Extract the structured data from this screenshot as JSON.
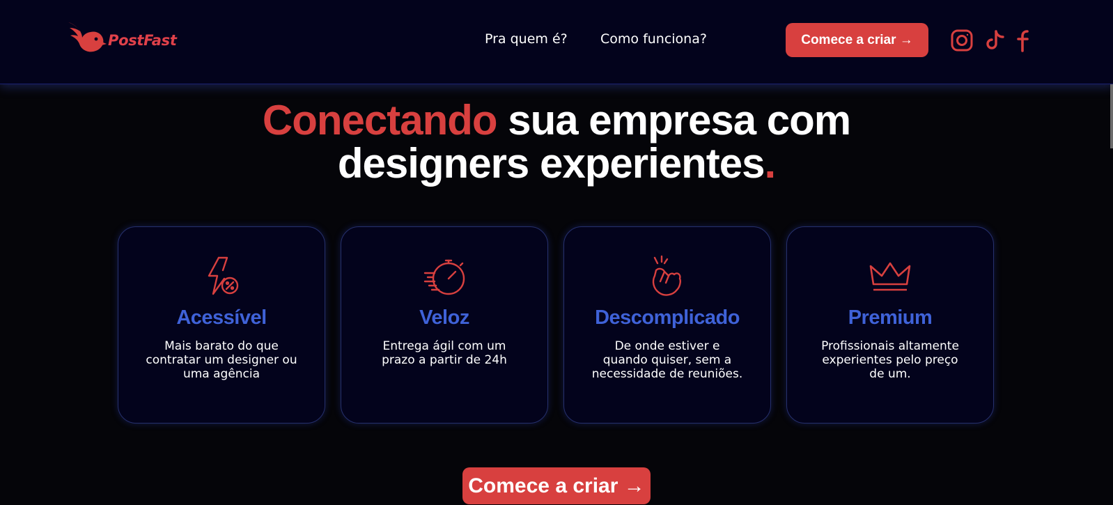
{
  "brand": {
    "name": "PostFast",
    "accent": "#d8403f",
    "secondary": "#3f62d8",
    "header_bg": "#03031c",
    "page_bg": "#050509"
  },
  "nav": {
    "items": [
      {
        "label": "Pra quem é?"
      },
      {
        "label": "Como funciona?"
      }
    ],
    "cta": "Comece a criar →"
  },
  "social": [
    {
      "icon": "instagram-icon"
    },
    {
      "icon": "tiktok-icon"
    },
    {
      "icon": "facebook-icon"
    }
  ],
  "hero": {
    "accent": "Conectando",
    "line1_rest": " sua empresa com",
    "line2": "designers experientes",
    "dot": "."
  },
  "features": [
    {
      "icon": "bolt-percent-icon",
      "title": "Acessível",
      "description": "Mais barato do que contratar um designer ou uma agência"
    },
    {
      "icon": "stopwatch-icon",
      "title": "Veloz",
      "description": "Entrega ágil com um prazo a partir de 24h"
    },
    {
      "icon": "hand-snap-icon",
      "title": "Descomplicado",
      "description": "De onde estiver e quando quiser, sem a necessidade de reuniões."
    },
    {
      "icon": "crown-icon",
      "title": "Premium",
      "description": "Profissionais altamente experientes pelo preço de um."
    }
  ],
  "main_cta": "Comece a criar →"
}
